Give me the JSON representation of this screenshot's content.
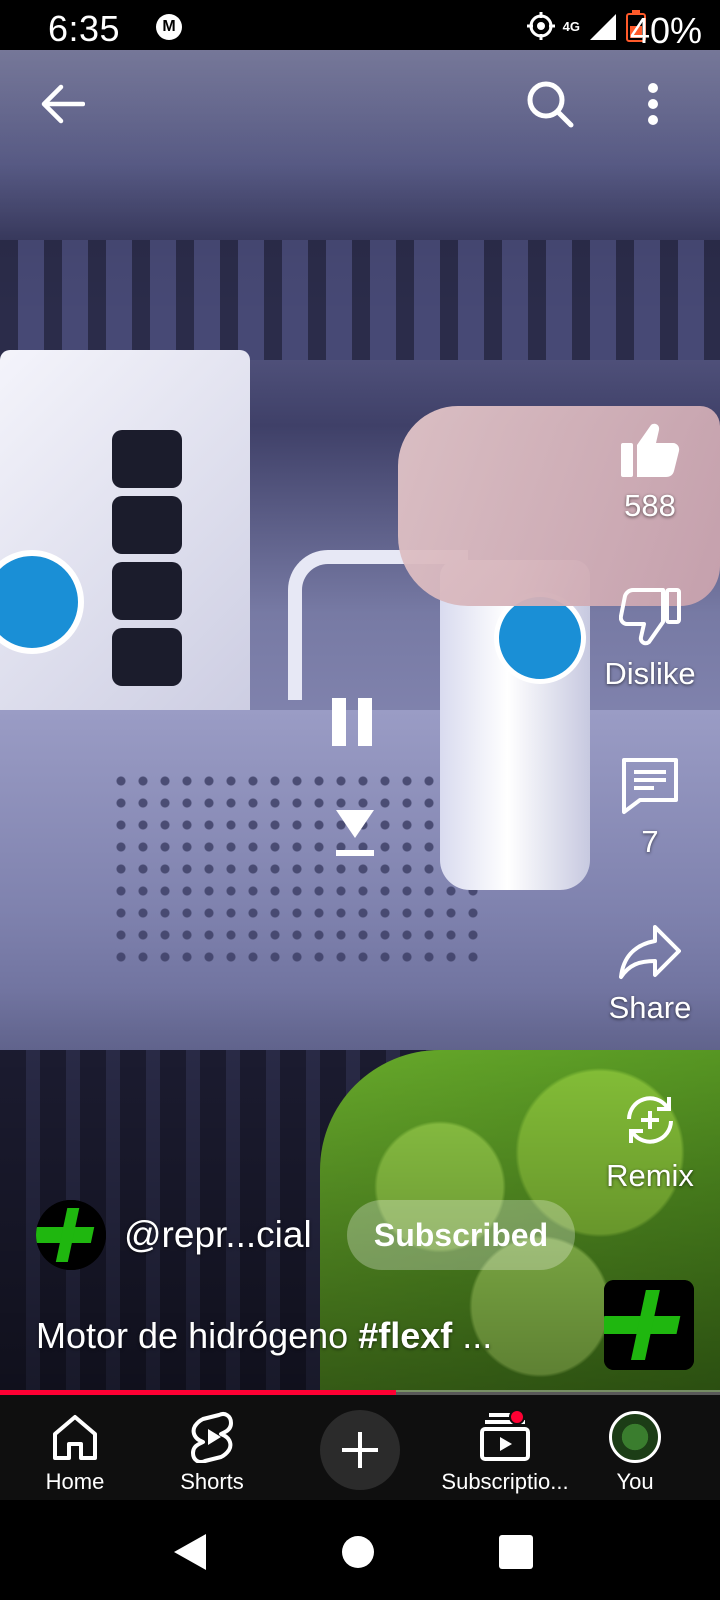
{
  "status_bar": {
    "time": "6:35",
    "notification_letter": "M",
    "network": "4G",
    "battery_percent": "40%"
  },
  "video": {
    "progress_fraction": 0.55
  },
  "actions": {
    "like_count": "588",
    "dislike_label": "Dislike",
    "comment_count": "7",
    "share_label": "Share",
    "remix_label": "Remix"
  },
  "channel": {
    "handle": "@repr...cial",
    "subscribe_label": "Subscribed"
  },
  "video_title": {
    "text": "Motor de hidrógeno ",
    "hashtag": "#flexf",
    "ellipsis": " ..."
  },
  "bottom_nav": {
    "home": "Home",
    "shorts": "Shorts",
    "subscriptions": "Subscriptio...",
    "you": "You"
  },
  "colors": {
    "accent_red": "#ff0033",
    "logo_green": "#1fb70f"
  },
  "icons": [
    "back-arrow-icon",
    "search-icon",
    "more-vert-icon",
    "pause-icon",
    "download-icon",
    "thumbs-up-icon",
    "thumbs-down-icon",
    "comment-icon",
    "share-icon",
    "remix-icon",
    "home-icon",
    "shorts-icon",
    "create-icon",
    "subscriptions-icon"
  ]
}
